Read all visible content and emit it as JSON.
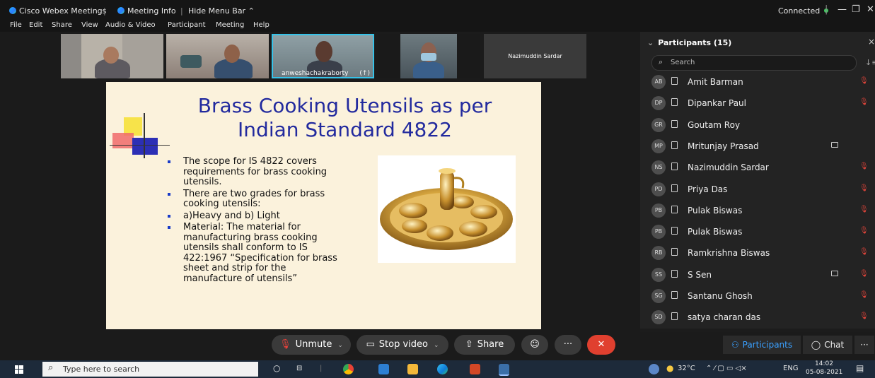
{
  "titlebar": {
    "app_name": "Cisco Webex Meetings",
    "meeting_info": "Meeting Info",
    "hide_menu": "Hide Menu Bar ⌃",
    "connection_status": "Connected",
    "minimize": "—",
    "restore": "❐",
    "close": "✕"
  },
  "menubar": [
    "File",
    "Edit",
    "Share",
    "View",
    "Audio & Video",
    "Participant",
    "Meeting",
    "Help"
  ],
  "video_thumbnails": [
    {
      "name": ""
    },
    {
      "name": ""
    },
    {
      "name": "anweshachakraborty",
      "active_speaker": true,
      "badge": "(↑)"
    },
    {
      "name": ""
    },
    {
      "name": "Nazimuddin Sardar"
    }
  ],
  "slide": {
    "title": "Brass Cooking Utensils as per Indian Standard 4822",
    "bullets": [
      "The scope for IS 4822 covers requirements for brass cooking utensils.",
      "There are two grades for brass cooking utensils:",
      "a)Heavy and b) Light",
      "Material: The material for manufacturing brass cooking utensils shall conform to IS 422:1967 “Specification for brass sheet and strip for the manufacture of utensils”"
    ]
  },
  "toolbar": {
    "unmute": "Unmute",
    "stop_video": "Stop video",
    "share": "Share",
    "more": "···",
    "end": "✕"
  },
  "participants_panel": {
    "title": "Participants (15)",
    "search_placeholder": "Search",
    "participants": [
      {
        "initials": "AB",
        "name": "Amit Barman",
        "muted": true,
        "video": false
      },
      {
        "initials": "DP",
        "name": "Dipankar Paul",
        "muted": true,
        "video": false
      },
      {
        "initials": "GR",
        "name": "Goutam Roy",
        "muted": false,
        "video": false
      },
      {
        "initials": "MP",
        "name": "Mritunjay Prasad",
        "muted": false,
        "video": true
      },
      {
        "initials": "NS",
        "name": "Nazimuddin Sardar",
        "muted": true,
        "video": false
      },
      {
        "initials": "PD",
        "name": "Priya Das",
        "muted": true,
        "video": false
      },
      {
        "initials": "PB",
        "name": "Pulak Biswas",
        "muted": true,
        "video": false
      },
      {
        "initials": "PB",
        "name": "Pulak Biswas",
        "muted": true,
        "video": false
      },
      {
        "initials": "RB",
        "name": "Ramkrishna Biswas",
        "muted": true,
        "video": false
      },
      {
        "initials": "SS",
        "name": "S Sen",
        "muted": true,
        "video": true
      },
      {
        "initials": "SG",
        "name": "Santanu Ghosh",
        "muted": true,
        "video": false
      },
      {
        "initials": "SD",
        "name": "satya charan das",
        "muted": true,
        "video": false
      }
    ],
    "participants_tab": "Participants",
    "chat_tab": "Chat",
    "more": "···"
  },
  "taskbar": {
    "search_placeholder": "Type here to search",
    "weather": "32°C",
    "tray_icons": "⌃ ⁄ ▢ ▭ ◁× ",
    "language": "ENG",
    "time": "14:02",
    "date": "05-08-2021"
  },
  "colors": {
    "accent": "#1c9bf0",
    "end_button": "#e0402f",
    "slide_title": "#222a9e",
    "active_speaker_border": "#36c2e8"
  }
}
